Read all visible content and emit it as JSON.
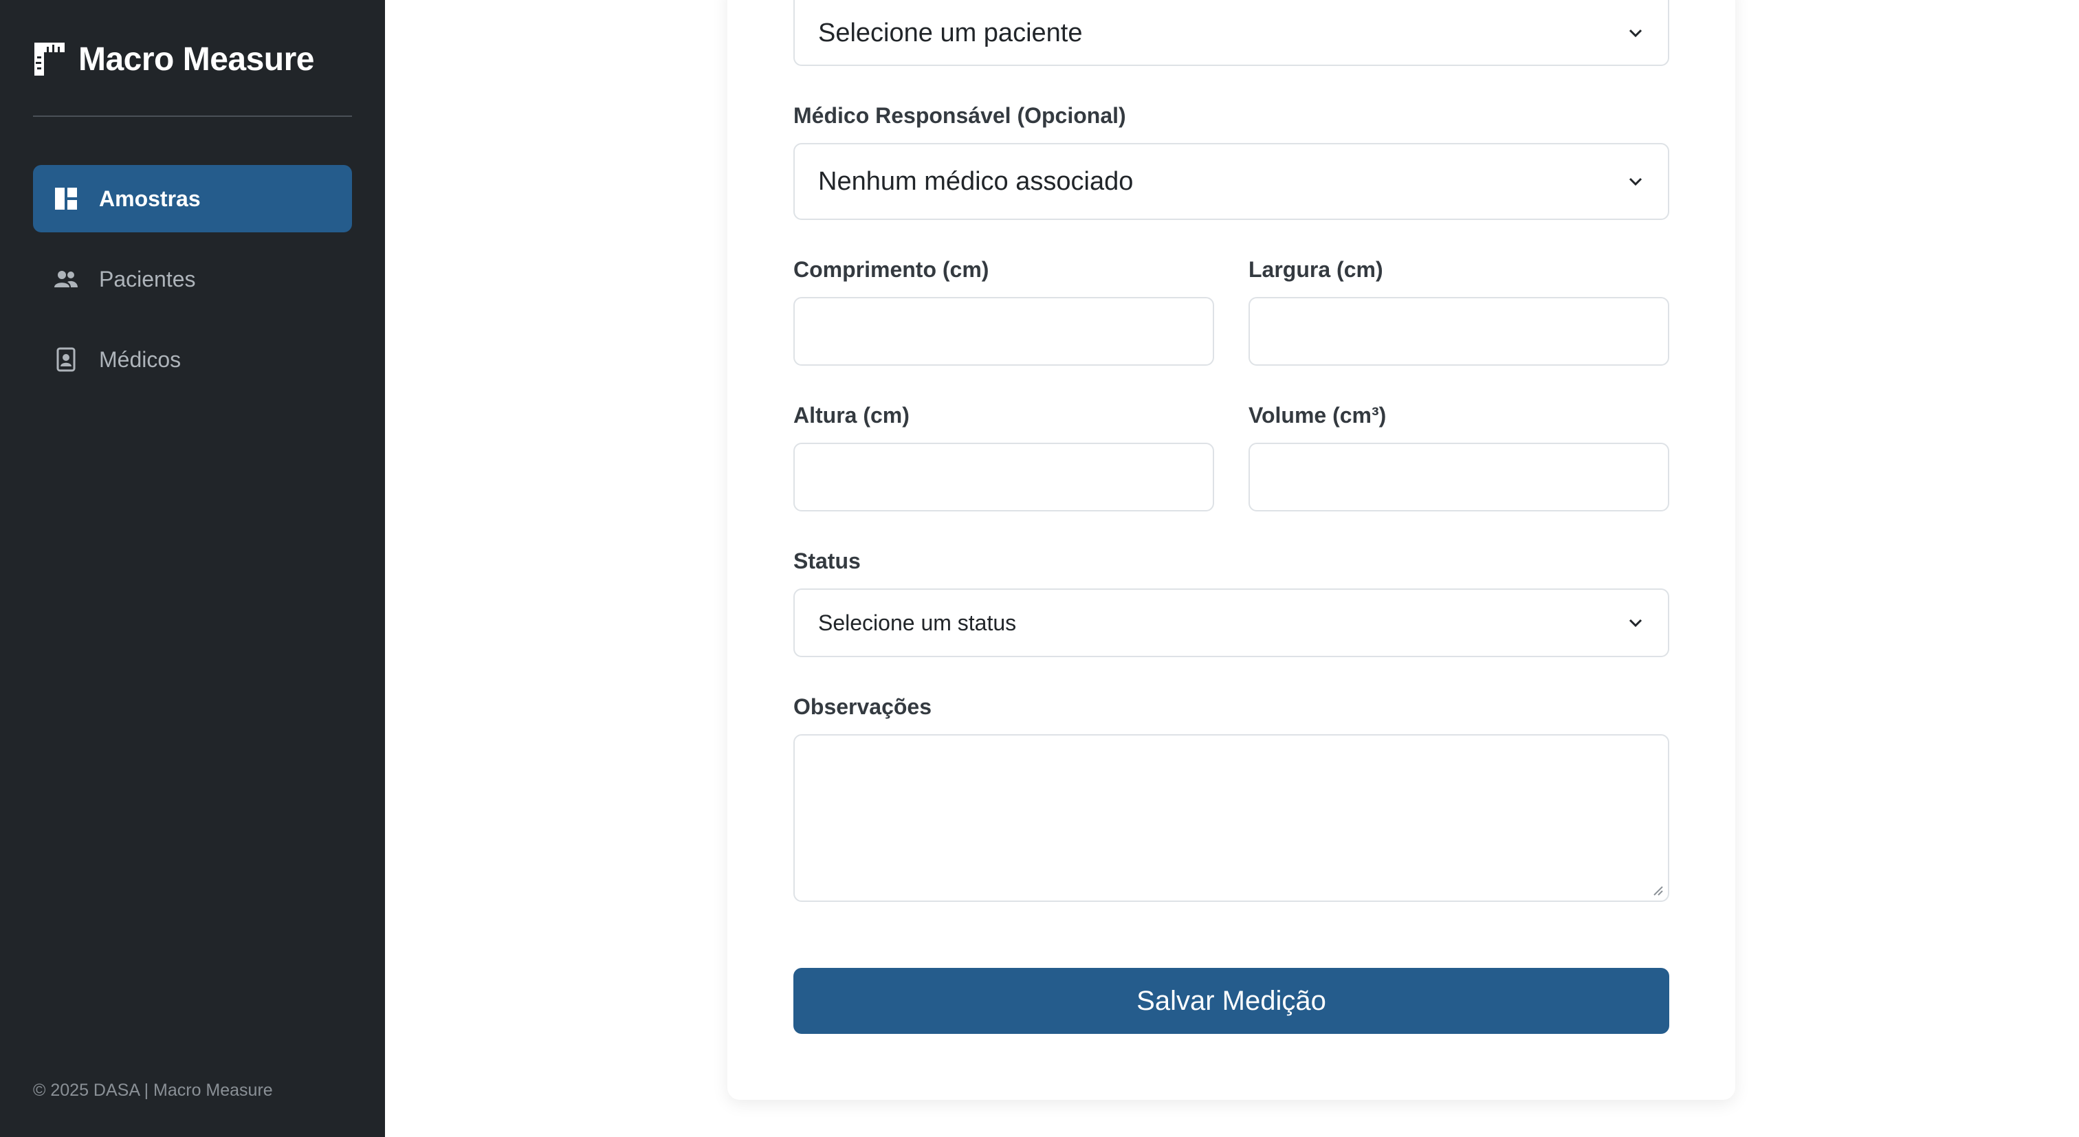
{
  "sidebar": {
    "brand": "Macro Measure",
    "brand_icon": "ruler-icon",
    "items": [
      {
        "label": "Amostras",
        "icon": "dashboard-icon",
        "active": true
      },
      {
        "label": "Pacientes",
        "icon": "people-icon",
        "active": false
      },
      {
        "label": "Médicos",
        "icon": "doctor-badge-icon",
        "active": false
      }
    ],
    "footer": "© 2025 DASA | Macro Measure"
  },
  "form": {
    "patient_select": {
      "value": "Selecione um paciente"
    },
    "doctor": {
      "label": "Médico Responsável (Opcional)",
      "value": "Nenhum médico associado"
    },
    "length": {
      "label": "Comprimento (cm)",
      "value": ""
    },
    "width": {
      "label": "Largura (cm)",
      "value": ""
    },
    "height": {
      "label": "Altura (cm)",
      "value": ""
    },
    "volume": {
      "label": "Volume (cm³)",
      "value": ""
    },
    "status": {
      "label": "Status",
      "value": "Selecione um status"
    },
    "notes": {
      "label": "Observações",
      "value": ""
    },
    "submit_label": "Salvar Medição"
  },
  "colors": {
    "sidebar_bg": "#212529",
    "accent": "#255c8c",
    "border": "#dee2e6"
  }
}
